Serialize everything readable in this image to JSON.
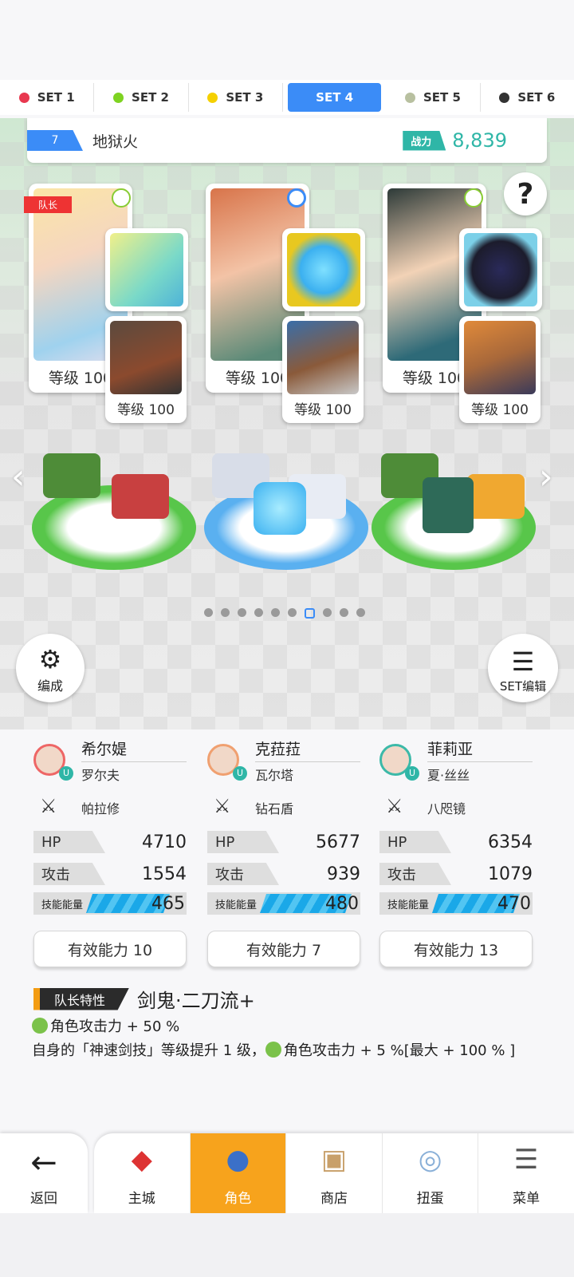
{
  "set_tabs": [
    {
      "label": "SET 1",
      "color": "#e8384f"
    },
    {
      "label": "SET 2",
      "color": "#7ed321"
    },
    {
      "label": "SET 3",
      "color": "#f5d000"
    },
    {
      "label": "SET 4",
      "color": "#3b8cf7",
      "active": true
    },
    {
      "label": "SET 5",
      "color": "#b8c0a0"
    },
    {
      "label": "SET 6",
      "color": "#333333"
    }
  ],
  "team": {
    "number": "7",
    "name": "地狱火",
    "power_label": "战力",
    "power_value": "8,839"
  },
  "help_icon": "?",
  "leader_tag": "队长",
  "cards": {
    "level_text": "等级 100"
  },
  "page_indicator": {
    "count": 10,
    "active": 6
  },
  "buttons": {
    "formation": "编成",
    "set_edit": "SET编辑"
  },
  "characters": [
    {
      "name": "希尔媞",
      "sub": "罗尔夫",
      "equip": "帕拉修",
      "hp": "4710",
      "atk": "1554",
      "energy": "465",
      "energy_fraction": 0.42,
      "effective": "有效能力 10",
      "ring": "#e66"
    },
    {
      "name": "克菈菈",
      "sub": "瓦尔塔",
      "equip": "钻石盾",
      "hp": "5677",
      "atk": "939",
      "energy": "480",
      "energy_fraction": 0.46,
      "effective": "有效能力 7",
      "ring": "#f0a070"
    },
    {
      "name": "菲莉亚",
      "sub": "夏·丝丝",
      "equip": "八咫镜",
      "hp": "6354",
      "atk": "1079",
      "energy": "470",
      "energy_fraction": 0.44,
      "effective": "有效能力 13",
      "ring": "#3cb9a8"
    }
  ],
  "labels": {
    "hp": "HP",
    "atk": "攻击",
    "energy": "技能能量",
    "u": "U"
  },
  "leader_trait": {
    "tag": "队长特性",
    "name": "剑鬼·二刀流+",
    "desc1": "角色攻击力 + 50 %",
    "desc2_pre": "自身的「神速剑技」等级提升 1 级，",
    "desc2_post": "角色攻击力 + 5 %[最大 + 100 % ]"
  },
  "nav": {
    "back": "返回",
    "items": [
      {
        "label": "主城",
        "icon": "castle-icon"
      },
      {
        "label": "角色",
        "icon": "character-icon",
        "active": true
      },
      {
        "label": "商店",
        "icon": "shop-icon"
      },
      {
        "label": "扭蛋",
        "icon": "gacha-icon"
      },
      {
        "label": "菜单",
        "icon": "menu-icon"
      }
    ]
  }
}
